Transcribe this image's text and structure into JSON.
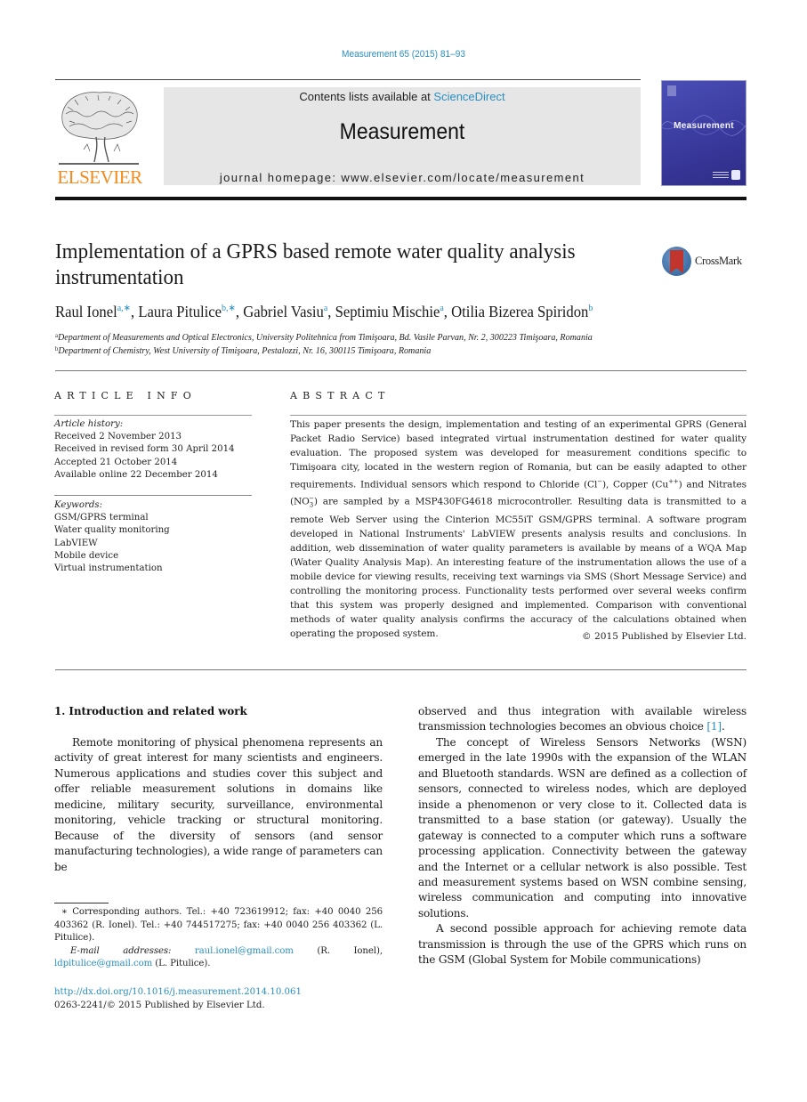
{
  "header": {
    "journal_ref": "Measurement 65 (2015) 81–93",
    "contents_prefix": "Contents lists available at ",
    "contents_link": "ScienceDirect",
    "journal_title": "Measurement",
    "homepage": "journal homepage: www.elsevier.com/locate/measurement",
    "publisher_logo": "ELSEVIER",
    "cover_title": "Measurement",
    "crossmark_label": "CrossMark"
  },
  "article": {
    "title": "Implementation of a GPRS based remote water quality analysis instrumentation",
    "authors": [
      {
        "name": "Raul Ionel",
        "sup": "a,∗"
      },
      {
        "name": "Laura Pitulice",
        "sup": "b,∗"
      },
      {
        "name": "Gabriel Vasiu",
        "sup": "a"
      },
      {
        "name": "Septimiu Mischie",
        "sup": "a"
      },
      {
        "name": "Otilia Bizerea Spiridon",
        "sup": "b"
      }
    ],
    "affiliations": [
      {
        "key": "a",
        "text": "Department of Measurements and Optical Electronics, University Politehnica from Timişoara, Bd. Vasile Parvan, Nr. 2, 300223 Timişoara, Romania"
      },
      {
        "key": "b",
        "text": "Department of Chemistry, West University of Timişoara, Pestalozzi, Nr. 16, 300115 Timişoara, Romania"
      }
    ]
  },
  "article_info": {
    "heading": "ARTICLE INFO",
    "history_label": "Article history:",
    "history": [
      "Received 2 November 2013",
      "Received in revised form 30 April 2014",
      "Accepted 21 October 2014",
      "Available online 22 December 2014"
    ],
    "keywords_label": "Keywords:",
    "keywords": [
      "GSM/GPRS terminal",
      "Water quality monitoring",
      "LabVIEW",
      "Mobile device",
      "Virtual instrumentation"
    ]
  },
  "abstract": {
    "heading": "ABSTRACT",
    "part1": "This paper presents the design, implementation and testing of an experimental GPRS (General Packet Radio Service) based integrated virtual instrumentation destined for water quality evaluation. The proposed system was developed for measurement conditions specific to Timişoara city, located in the western region of Romania, but can be easily adapted to other requirements. Individual sensors which respond to Chloride (Cl",
    "sup_cl": "−",
    "part2": "), Copper (Cu",
    "sup_cu": "++",
    "part3": ") and Nitrates (NO",
    "sub_no": "3",
    "sup_no": "−",
    "part4": ") are sampled by a MSP430FG4618 microcontroller. Resulting data is transmitted to a remote Web Server using the Cinterion MC55iT GSM/GPRS terminal. A software program developed in National Instruments' LabVIEW presents analysis results and conclusions. In addition, web dissemination of water quality parameters is available by means of a WQA Map (Water Quality Analysis Map). An interesting feature of the instrumentation allows the use of a mobile device for viewing results, receiving text warnings via SMS (Short Message Service) and controlling the monitoring process. Functionality tests performed over several weeks confirm that this system was properly designed and implemented. Comparison with conventional methods of water quality analysis confirms the accuracy of the calculations obtained when operating the proposed system.",
    "copyright": "© 2015 Published by Elsevier Ltd."
  },
  "body": {
    "section_heading": "1. Introduction and related work",
    "left_para1": "Remote monitoring of physical phenomena represents an activity of great interest for many scientists and engineers. Numerous applications and studies cover this subject and offer reliable measurement solutions in domains like medicine, military security, surveillance, environmental monitoring, vehicle tracking or structural monitoring. Because of the diversity of sensors (and sensor manufacturing technologies), a wide range of parameters can be",
    "right_para1": "observed and thus integration with available wireless transmission technologies becomes an obvious choice ",
    "right_para1_ref": "[1]",
    "right_para1_end": ".",
    "right_para2": "The concept of Wireless Sensors Networks (WSN) emerged in the late 1990s with the expansion of the WLAN and Bluetooth standards. WSN are defined as a collection of sensors, connected to wireless nodes, which are deployed inside a phenomenon or very close to it. Collected data is transmitted to a base station (or gateway). Usually the gateway is connected to a computer which runs a software processing application. Connectivity between the gateway and the Internet or a cellular network is also possible. Test and measurement systems based on WSN combine sensing, wireless communication and computing into innovative solutions.",
    "right_para3": "A second possible approach for achieving remote data transmission is through the use of the GPRS which runs on the GSM (Global System for Mobile communications)"
  },
  "footnotes": {
    "corresponding": "∗ Corresponding authors. Tel.: +40 723619912; fax: +40 0040 256 403362 (R. Ionel). Tel.: +40 744517275; fax: +40 0040 256 403362 (L. Pitulice).",
    "email_label": "E-mail addresses:",
    "email1": "raul.ionel@gmail.com",
    "email1_owner": " (R. Ionel), ",
    "email2": "ldpitulice@gmail.com",
    "email2_owner": " (L. Pitulice).",
    "doi": "http://dx.doi.org/10.1016/j.measurement.2014.10.061",
    "issn": "0263-2241/© 2015 Published by Elsevier Ltd."
  }
}
